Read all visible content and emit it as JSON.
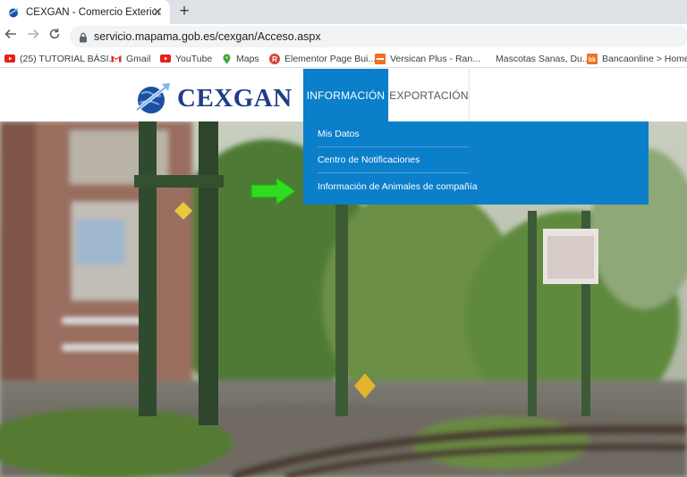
{
  "browser": {
    "tab_title": "CEXGAN - Comercio Exterior",
    "tab_close": "✕",
    "new_tab": "+",
    "url": "servicio.mapama.gob.es/cexgan/Acceso.aspx",
    "bookmarks": [
      {
        "label": "(25) TUTORIAL BÁSI...",
        "icon": "youtube-icon"
      },
      {
        "label": "Gmail",
        "icon": "gmail-icon"
      },
      {
        "label": "YouTube",
        "icon": "youtube-icon"
      },
      {
        "label": "Maps",
        "icon": "maps-icon"
      },
      {
        "label": "Elementor Page Bui...",
        "icon": "elementor-icon"
      },
      {
        "label": "Versican Plus - Ran...",
        "icon": "versican-icon"
      },
      {
        "label": "Mascotas Sanas, Du...",
        "icon": "mascotas-icon"
      },
      {
        "label": "Bancaonline > Home",
        "icon": "bank-icon"
      }
    ]
  },
  "site": {
    "logo_text": "CEXGAN",
    "nav": [
      {
        "label": "INFORMACIÓN",
        "active": true
      },
      {
        "label": "EXPORTACIÓN",
        "active": false
      }
    ],
    "dropdown": [
      {
        "label": "Mis Datos"
      },
      {
        "label": "Centro de Notificaciones"
      },
      {
        "label": "Información de Animales de compañía"
      }
    ]
  },
  "colors": {
    "accent": "#0b7fca",
    "logo": "#1f3c88",
    "arrow": "#2fdc1e"
  }
}
